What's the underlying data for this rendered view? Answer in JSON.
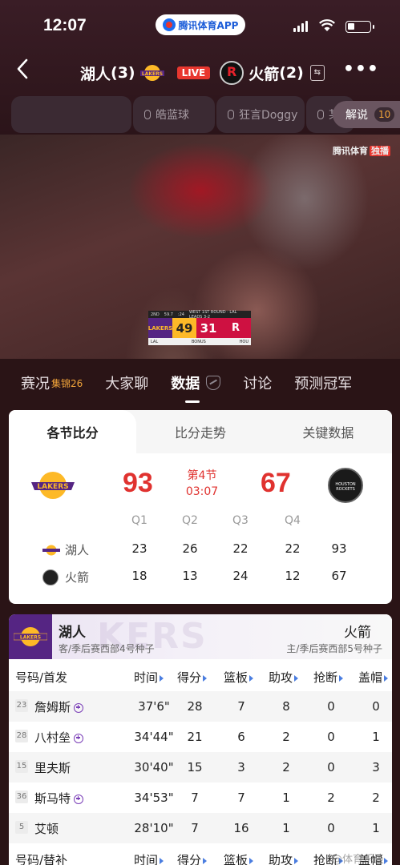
{
  "status_bar": {
    "time": "12:07",
    "app_label": "腾讯体育APP"
  },
  "header": {
    "home_team": "湖人",
    "home_count": "(3)",
    "live": "LIVE",
    "away_team": "火箭",
    "away_count": "(2)"
  },
  "commentary": {
    "channels": [
      "皓蓝球",
      "狂言Doggy",
      "某"
    ],
    "jieshuo_label": "解说",
    "jieshuo_count": "10"
  },
  "video": {
    "watermark": "腾讯体育",
    "watermark_tag": "独播",
    "bug": {
      "header_left": "2ND",
      "clock": "59.7",
      "shot": ":24",
      "series_info": "WEST 1ST ROUND · LAL LEADS 3-2",
      "home_abbr": "LAKERS",
      "home_score": "49",
      "away_score": "31",
      "footer_left": "LAL",
      "footer_mid": "BONUS",
      "footer_right": "HOU"
    }
  },
  "tabs": [
    {
      "label": "赛况",
      "sub": "集锦26"
    },
    {
      "label": "大家聊",
      "sub": ""
    },
    {
      "label": "数据",
      "sub": ""
    },
    {
      "label": "讨论",
      "sub": ""
    },
    {
      "label": "预测冠军",
      "sub": ""
    }
  ],
  "score_card": {
    "tabs": [
      "各节比分",
      "比分走势",
      "关键数据"
    ],
    "home_score": "93",
    "away_score": "67",
    "period": "第4节",
    "clock": "03:07",
    "quarter_headers": [
      "Q1",
      "Q2",
      "Q3",
      "Q4"
    ],
    "rows": [
      {
        "team": "湖人",
        "q": [
          "23",
          "26",
          "22",
          "22"
        ],
        "total": "93"
      },
      {
        "team": "火箭",
        "q": [
          "18",
          "13",
          "24",
          "12"
        ],
        "total": "67"
      }
    ]
  },
  "player_card": {
    "home_team": "湖人",
    "home_sub": "客/季后赛西部4号种子",
    "away_team": "火箭",
    "away_sub": "主/季后赛西部5号种子",
    "ghost_text": "KERS",
    "starters_header": [
      "号码/首发",
      "时间",
      "得分",
      "篮板",
      "助攻",
      "抢断",
      "盖帽"
    ],
    "bench_header": [
      "号码/替补",
      "时间",
      "得分",
      "篮板",
      "助攻",
      "抢断",
      "盖帽"
    ],
    "starters": [
      {
        "num": "23",
        "name": "詹姆斯",
        "plus": true,
        "min": "37'6\"",
        "pts": "28",
        "reb": "7",
        "ast": "8",
        "stl": "0",
        "blk": "0"
      },
      {
        "num": "28",
        "name": "八村垒",
        "plus": true,
        "min": "34'44\"",
        "pts": "21",
        "reb": "6",
        "ast": "2",
        "stl": "0",
        "blk": "1"
      },
      {
        "num": "15",
        "name": "里夫斯",
        "plus": false,
        "min": "30'40\"",
        "pts": "15",
        "reb": "3",
        "ast": "2",
        "stl": "0",
        "blk": "3"
      },
      {
        "num": "36",
        "name": "斯马特",
        "plus": true,
        "min": "34'53\"",
        "pts": "7",
        "reb": "7",
        "ast": "1",
        "stl": "2",
        "blk": "2"
      },
      {
        "num": "5",
        "name": "艾顿",
        "plus": false,
        "min": "28'10\"",
        "pts": "7",
        "reb": "16",
        "ast": "1",
        "stl": "0",
        "blk": "1"
      }
    ],
    "watermark": "@体育乐谈"
  },
  "colors": {
    "accent_red": "#e0322f",
    "lakers_purple": "#552583",
    "lakers_gold": "#fdb927",
    "orange": "#f3a53a"
  }
}
